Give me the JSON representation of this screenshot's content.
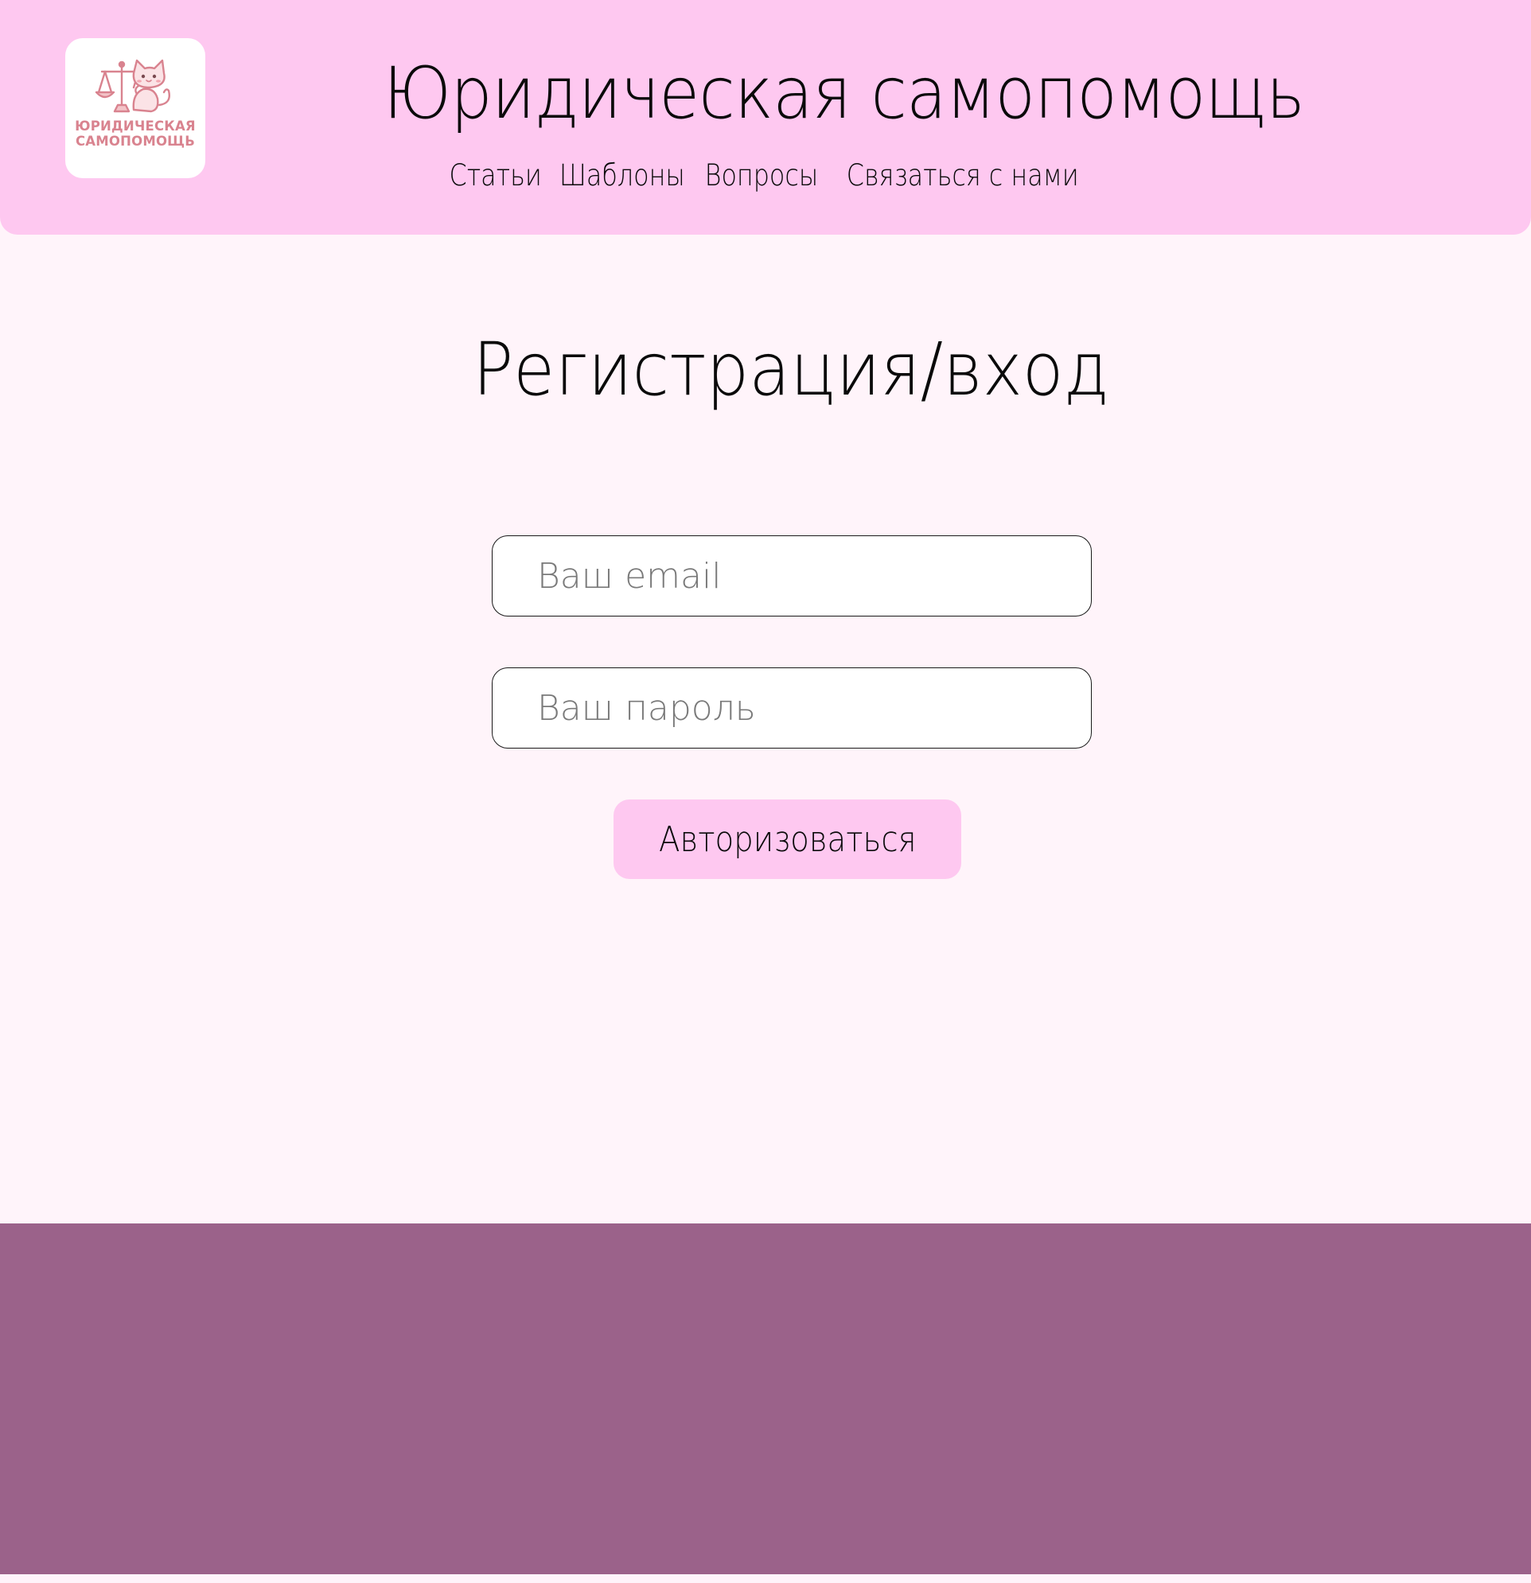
{
  "header": {
    "logo": {
      "line1": "ЮРИДИЧЕСКАЯ",
      "line2": "САМОПОМОЩЬ",
      "color": "#d9838f"
    },
    "title": "Юридическая самопомощь",
    "nav": [
      {
        "label": "Статьи"
      },
      {
        "label": "Шаблоны"
      },
      {
        "label": "Вопросы"
      },
      {
        "label": "Связаться с нами"
      }
    ],
    "background": "#fec8f0"
  },
  "main": {
    "heading": "Регистрация/вход",
    "email": {
      "placeholder": "Ваш email",
      "value": ""
    },
    "password": {
      "placeholder": "Ваш пароль",
      "value": ""
    },
    "submit_label": "Авторизоваться",
    "background": "#fff4fa"
  },
  "footer": {
    "background": "#9b628a"
  }
}
